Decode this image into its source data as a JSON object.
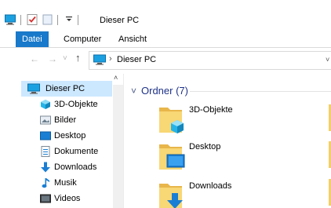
{
  "window": {
    "title": "Dieser PC"
  },
  "quick_access": {
    "icons": [
      "computer-icon",
      "properties-check-icon",
      "new-folder-icon"
    ],
    "dropdown_icon": "chevron-down-icon"
  },
  "ribbon": {
    "tabs": [
      {
        "label": "Datei",
        "active": true
      },
      {
        "label": "Computer",
        "active": false
      },
      {
        "label": "Ansicht",
        "active": false
      }
    ]
  },
  "address": {
    "back_icon": "←",
    "forward_icon": "→",
    "history_icon": "˅",
    "up_icon": "↑",
    "separator": "›",
    "path": "Dieser PC",
    "dropdown": "˅"
  },
  "nav": {
    "scroll_up": "˄",
    "items": [
      {
        "label": "Dieser PC",
        "icon": "this-pc-icon",
        "selected": true
      },
      {
        "label": "3D-Objekte",
        "icon": "3d-objects-icon"
      },
      {
        "label": "Bilder",
        "icon": "pictures-icon"
      },
      {
        "label": "Desktop",
        "icon": "desktop-icon"
      },
      {
        "label": "Dokumente",
        "icon": "documents-icon"
      },
      {
        "label": "Downloads",
        "icon": "downloads-icon"
      },
      {
        "label": "Musik",
        "icon": "music-icon"
      },
      {
        "label": "Videos",
        "icon": "videos-icon"
      }
    ]
  },
  "content": {
    "group_chevron": "˅",
    "group_title": "Ordner (7)",
    "folders": [
      {
        "label": "3D-Objekte",
        "icon": "3d-objects-folder-icon"
      },
      {
        "label": "Desktop",
        "icon": "desktop-folder-icon"
      },
      {
        "label": "Downloads",
        "icon": "downloads-folder-icon"
      }
    ]
  },
  "colors": {
    "accent": "#1979ca",
    "selection": "#cce8ff",
    "group_title": "#1e3287",
    "folder": "#f3cf6b"
  }
}
